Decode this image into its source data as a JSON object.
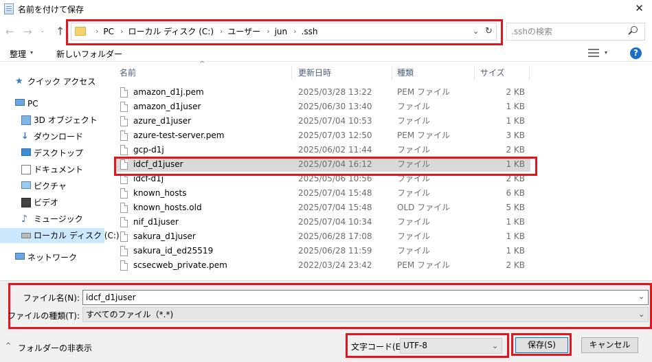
{
  "window": {
    "title": "名前を付けて保存",
    "close_glyph": "✕"
  },
  "nav": {
    "back_glyph": "←",
    "forward_glyph": "→",
    "history_glyph": "⌄",
    "up_glyph": "↑",
    "breadcrumbs": [
      "PC",
      "ローカル ディスク (C:)",
      "ユーザー",
      "jun",
      ".ssh"
    ],
    "separator": "›",
    "dropdown_glyph": "⌄",
    "refresh_glyph": "↻"
  },
  "search": {
    "placeholder": ".sshの検索",
    "value": ""
  },
  "toolbar": {
    "organize_label": "整理",
    "new_folder_label": "新しいフォルダー",
    "caret_glyph": "▾",
    "help_label": "?"
  },
  "sidebar": {
    "items": [
      {
        "label": "クイック アクセス",
        "icon": "star-icon"
      },
      {
        "label": "PC",
        "icon": "computer-icon"
      },
      {
        "label": "3D オブジェクト",
        "icon": "cube-icon"
      },
      {
        "label": "ダウンロード",
        "icon": "download-icon"
      },
      {
        "label": "デスクトップ",
        "icon": "desktop-icon"
      },
      {
        "label": "ドキュメント",
        "icon": "document-icon"
      },
      {
        "label": "ピクチャ",
        "icon": "picture-icon"
      },
      {
        "label": "ビデオ",
        "icon": "video-icon"
      },
      {
        "label": "ミュージック",
        "icon": "music-icon"
      },
      {
        "label": "ローカル ディスク (C:)",
        "icon": "drive-icon"
      },
      {
        "label": "ネットワーク",
        "icon": "network-icon"
      }
    ]
  },
  "filelist": {
    "columns": {
      "name": "名前",
      "date": "更新日時",
      "type": "種類",
      "size": "サイズ"
    },
    "sort_glyph": "^",
    "rows": [
      {
        "name": "amazon_d1j.pem",
        "date": "2025/03/28 13:22",
        "type": "PEM ファイル",
        "size": "2 KB"
      },
      {
        "name": "amazon_d1juser",
        "date": "2025/06/30 13:40",
        "type": "ファイル",
        "size": "1 KB"
      },
      {
        "name": "azure_d1juser",
        "date": "2025/07/04 10:53",
        "type": "ファイル",
        "size": "1 KB"
      },
      {
        "name": "azure-test-server.pem",
        "date": "2025/07/03 12:50",
        "type": "PEM ファイル",
        "size": "3 KB"
      },
      {
        "name": "gcp-d1j",
        "date": "2025/06/02 11:44",
        "type": "ファイル",
        "size": "2 KB"
      },
      {
        "name": "idcf_d1juser",
        "date": "2025/07/04 16:12",
        "type": "ファイル",
        "size": "1 KB"
      },
      {
        "name": "idcf-d1j",
        "date": "2025/05/06 10:56",
        "type": "ファイル",
        "size": "2 KB"
      },
      {
        "name": "known_hosts",
        "date": "2025/07/04 15:48",
        "type": "ファイル",
        "size": "6 KB"
      },
      {
        "name": "known_hosts.old",
        "date": "2025/07/04 15:48",
        "type": "OLD ファイル",
        "size": "5 KB"
      },
      {
        "name": "nif_d1juser",
        "date": "2025/07/04 10:34",
        "type": "ファイル",
        "size": "1 KB"
      },
      {
        "name": "sakura_d1juser",
        "date": "2025/06/28 17:08",
        "type": "ファイル",
        "size": "1 KB"
      },
      {
        "name": "sakura_id_ed25519",
        "date": "2025/06/28 11:59",
        "type": "ファイル",
        "size": "1 KB"
      },
      {
        "name": "scsecweb_private.pem",
        "date": "2022/03/24 23:42",
        "type": "PEM ファイル",
        "size": "2 KB"
      }
    ]
  },
  "form": {
    "filename_label": "ファイル名(N):",
    "filename_value": "idcf_d1juser",
    "filetype_label": "ファイルの種類(T):",
    "filetype_value": "すべてのファイル（*.*)",
    "caret_glyph": "⌄",
    "hide_folders_label": "フォルダーの非表示",
    "hide_folders_glyph": "^",
    "encoding_label": "文字コード(E):",
    "encoding_value": "UTF-8",
    "save_label": "保存(S)",
    "cancel_label": "キャンセル"
  },
  "colors": {
    "highlight": "#e2141c",
    "selection": "#cce8ff",
    "row_selected": "#d9d9d9",
    "accent": "#0078d7"
  }
}
